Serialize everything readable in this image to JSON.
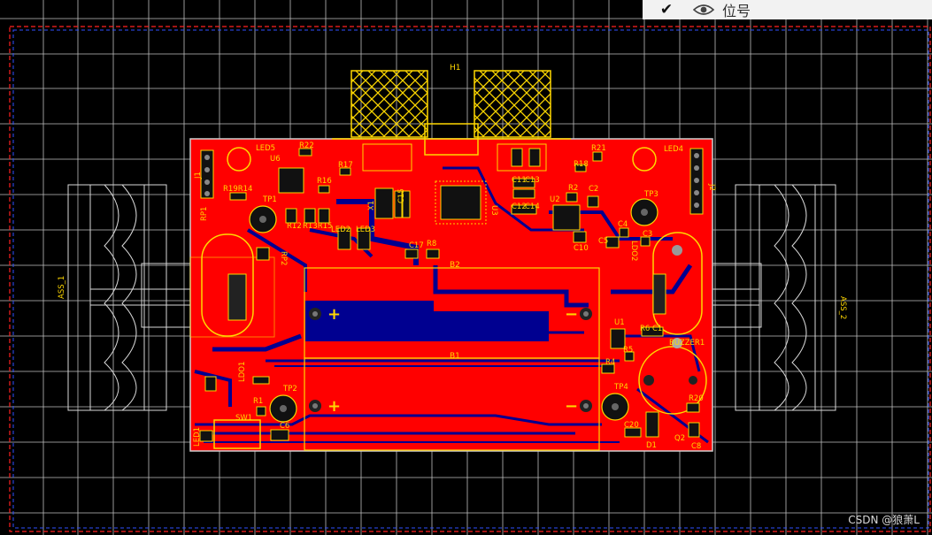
{
  "layer_bar": {
    "check_icon": "check-icon",
    "eye_icon": "eye-icon",
    "label": "位号"
  },
  "watermark": "CSDN @狼萧L",
  "colors": {
    "board": "#ff0000",
    "silk": "#ffd700",
    "bottom": "#000090",
    "grid": "#ffffff",
    "outline": "#d0d0d0"
  },
  "designators": {
    "h1": "H1",
    "led5": "LED5",
    "led4": "LED4",
    "r22": "R22",
    "r21": "R21",
    "u6": "U6",
    "r17": "R17",
    "r18": "R18",
    "r16": "R16",
    "r19r14": "R19R14",
    "j1": "J1",
    "j2": "J2",
    "tp1": "TP1",
    "tp3": "TP3",
    "tp2": "TP2",
    "tp4": "TP4",
    "rp1": "RP1",
    "rp2": "RP2",
    "x1": "X1",
    "c15": "C15",
    "c11": "C11",
    "c13": "C13",
    "c12": "C12",
    "c14": "C14",
    "u2": "U2",
    "r2": "R2",
    "c2": "C2",
    "r12": "R12",
    "r13r15": "R13R15",
    "led2": "LED2",
    "led3": "LED3",
    "u3": "U3",
    "c4": "C4",
    "c3": "C3",
    "c5": "C5",
    "c10": "C10",
    "c17": "C17",
    "r8": "R8",
    "b2": "B2",
    "b1": "B1",
    "ass1": "ASS_1",
    "ass2": "ASS_2",
    "ldo1": "LDO1",
    "ldo2": "LDO2",
    "u1": "U1",
    "r6": "R6",
    "c1": "C1",
    "buzzer1": "BUZZER1",
    "r4": "R4",
    "r5": "R5",
    "r20": "R20",
    "c20": "C20",
    "d1": "D1",
    "q2": "Q2",
    "c8": "C8",
    "r1": "R1",
    "sw1": "SW1",
    "c6": "C6",
    "led1": "LED1",
    "plus": "+",
    "minus": "−"
  }
}
